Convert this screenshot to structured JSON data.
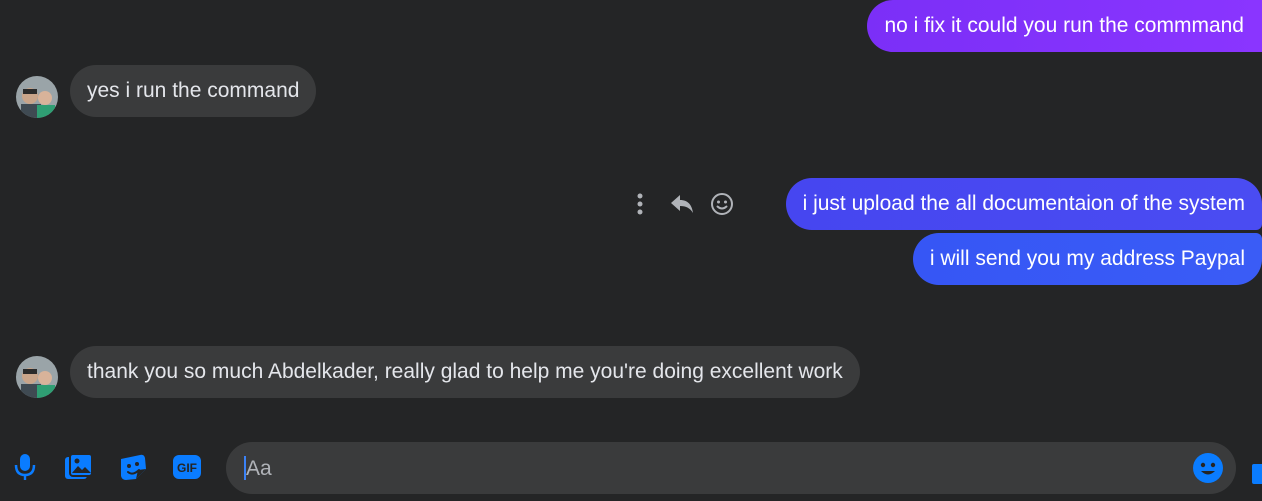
{
  "messages": [
    {
      "from": "me",
      "text": "no i fix it could you run the commmand"
    },
    {
      "from": "them",
      "text": "yes i run the command"
    },
    {
      "from": "me",
      "text": "i just upload the all documentaion of the system"
    },
    {
      "from": "me",
      "text": "i will send you my address Paypal"
    },
    {
      "from": "them",
      "text": "thank you so much Abdelkader, really glad to help me you're doing excellent work"
    }
  ],
  "message_actions": {
    "icons": [
      "more-options-icon",
      "reply-icon",
      "react-emoji-icon"
    ]
  },
  "composer": {
    "placeholder": "Aa",
    "tools": [
      "microphone-icon",
      "photo-icon",
      "sticker-icon",
      "gif-icon"
    ],
    "gif_label": "GIF"
  },
  "colors": {
    "background": "#242526",
    "incoming_bubble": "#3a3b3c",
    "outgoing_gradient_top": "#8a2be2",
    "outgoing_gradient_bottom": "#2f5bff",
    "accent": "#1877f2"
  }
}
